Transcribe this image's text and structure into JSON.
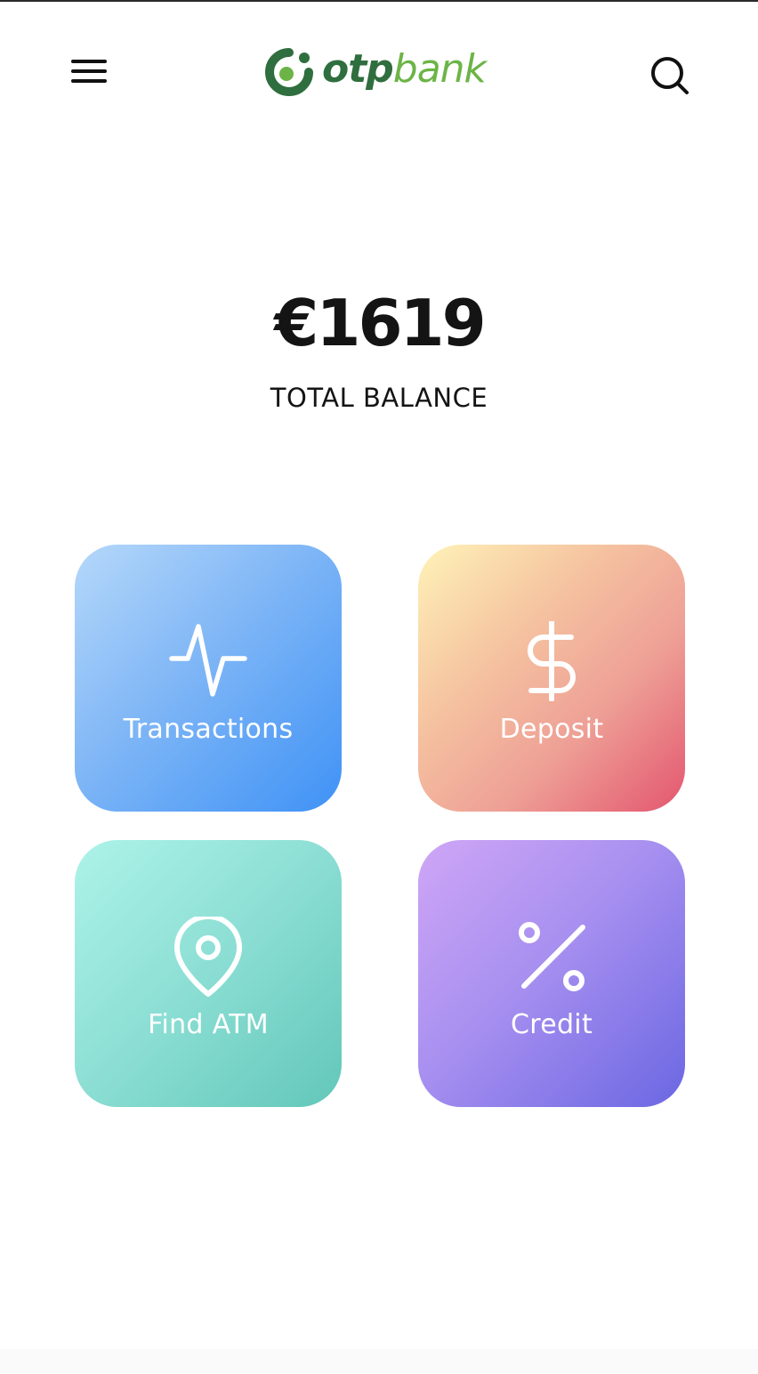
{
  "header": {
    "menu_icon": "hamburger-menu-icon",
    "logo": {
      "text_primary": "otp",
      "text_secondary": "bank",
      "primary_color": "#2f6e3e",
      "secondary_color": "#6cb447"
    },
    "search_icon": "search-icon"
  },
  "balance": {
    "amount": "€1619",
    "label": "TOTAL BALANCE"
  },
  "tiles": [
    {
      "label": "Transactions",
      "icon": "activity-pulse-icon",
      "gradient": [
        "#b5d8fa",
        "#3f92f6"
      ]
    },
    {
      "label": "Deposit",
      "icon": "dollar-sign-icon",
      "gradient": [
        "#fff3b8",
        "#e3566f"
      ]
    },
    {
      "label": "Find ATM",
      "icon": "map-pin-icon",
      "gradient": [
        "#adf3e9",
        "#62c7b9"
      ]
    },
    {
      "label": "Credit",
      "icon": "percent-icon",
      "gradient": [
        "#cfa6f6",
        "#6b67e2"
      ]
    }
  ]
}
